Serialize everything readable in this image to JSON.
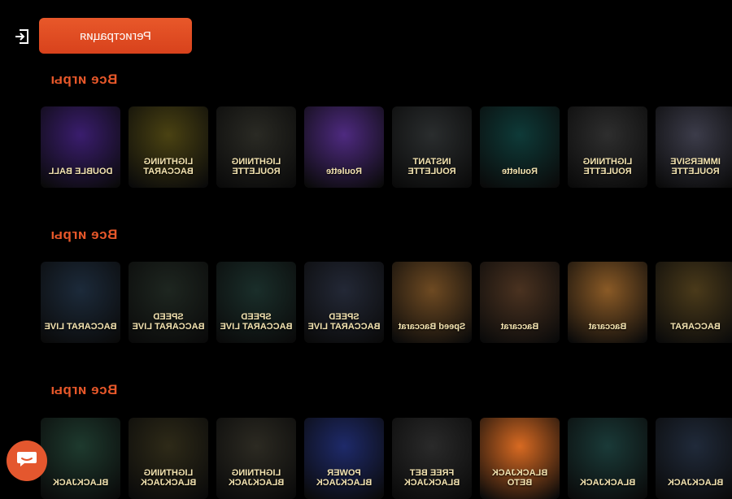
{
  "header": {
    "register_label": "Регистрация",
    "login_icon": "login-icon"
  },
  "sections": [
    {
      "title": "Все игры",
      "tiles": [
        {
          "label": "DOUBLE BALL",
          "bg": "#3a1d6e"
        },
        {
          "label": "LIGHTNING BACCARAT",
          "bg": "#4a4212"
        },
        {
          "label": "LIGHTNING ROULETTE",
          "bg": "#2a2a24"
        },
        {
          "label": "Roulette",
          "bg": "#4e2a80"
        },
        {
          "label": "INSTANT ROULETTE",
          "bg": "#2a2d2e"
        },
        {
          "label": "Roulette",
          "bg": "#0e3a38"
        },
        {
          "label": "LIGHTNING ROULETTE",
          "bg": "#2e2e2e"
        },
        {
          "label": "IMMERSIVE ROULETTE",
          "bg": "#3c3c4a"
        }
      ]
    },
    {
      "title": "Все игры",
      "tiles": [
        {
          "label": "BACCARAT LIVE",
          "bg": "#1c2a3a"
        },
        {
          "label": "SPEED BACCARAT LIVE",
          "bg": "#1e2620"
        },
        {
          "label": "SPEED BACCARAT LIVE",
          "bg": "#1a2e2a"
        },
        {
          "label": "SPEED BACCARAT LIVE",
          "bg": "#232836"
        },
        {
          "label": "Speed Baccarat",
          "bg": "#6e4a22"
        },
        {
          "label": "Baccarat",
          "bg": "#4a3220"
        },
        {
          "label": "Baccarat",
          "bg": "#8a5a26"
        },
        {
          "label": "BACCARAT",
          "bg": "#4a3a1a"
        }
      ]
    },
    {
      "title": "Все игры",
      "tiles": [
        {
          "label": "BLACKJACK",
          "bg": "#1e3a2e"
        },
        {
          "label": "LIGHTNING BLACKJACK",
          "bg": "#2e2a18"
        },
        {
          "label": "LIGHTNING BLACKJACK",
          "bg": "#2c2a22"
        },
        {
          "label": "POWER BLACKJACK",
          "bg": "#1e2a6a"
        },
        {
          "label": "FREE BET BLACKJACK",
          "bg": "#2a2a2a"
        },
        {
          "label": "BLACKJACK BETO",
          "bg": "#d86a22"
        },
        {
          "label": "BLACKJACK",
          "bg": "#1a3a38"
        },
        {
          "label": "BLACKJACK",
          "bg": "#202a3a"
        }
      ]
    }
  ],
  "chat": {
    "icon": "chat-icon"
  }
}
